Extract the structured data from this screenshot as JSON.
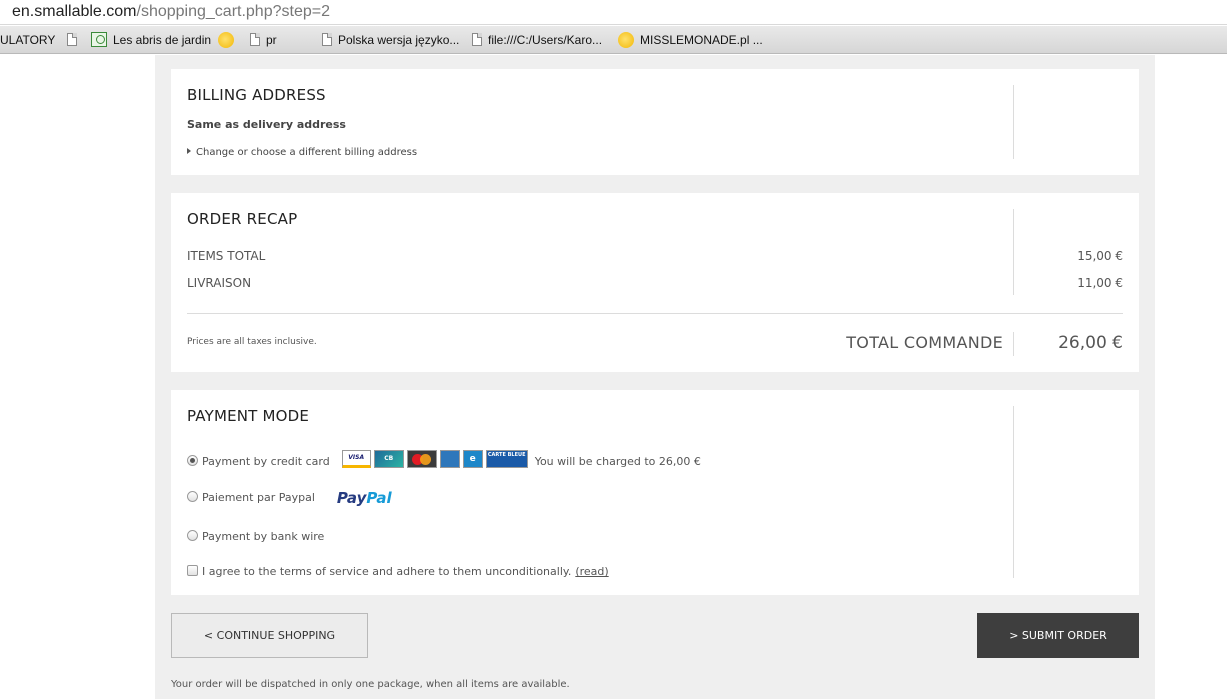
{
  "browser": {
    "url_host": "en.smallable.com",
    "url_path": "/shopping_cart.php?step=2",
    "bookmarks": [
      {
        "label": "ULATORY",
        "icon": "none"
      },
      {
        "label": "",
        "icon": "page-icon"
      },
      {
        "label": "Les abris de jardin",
        "icon": "tree-icon"
      },
      {
        "label": "",
        "icon": "hand-icon"
      },
      {
        "label": "pr",
        "icon": "page-icon"
      },
      {
        "label": "Polska wersja językо...",
        "icon": "page-icon"
      },
      {
        "label": "file:///C:/Users/Karo...",
        "icon": "page-icon"
      },
      {
        "label": "MISSLEMONADE.pl ...",
        "icon": "hand-icon"
      }
    ]
  },
  "billing": {
    "title": "BILLING ADDRESS",
    "same_as": "Same as delivery address",
    "change_link": "Change or choose a different billing address"
  },
  "recap": {
    "title": "ORDER RECAP",
    "lines": [
      {
        "label": "ITEMS TOTAL",
        "value": "15,00 €"
      },
      {
        "label": "LIVRAISON",
        "value": "11,00 €"
      }
    ],
    "taxes_note": "Prices are all taxes inclusive.",
    "total_label": "TOTAL COMMANDE",
    "total_value": "26,00 €"
  },
  "payment": {
    "title": "PAYMENT MODE",
    "options": [
      {
        "label": "Payment by credit card",
        "checked": true
      },
      {
        "label": "Paiement par Paypal",
        "checked": false
      },
      {
        "label": "Payment by bank wire",
        "checked": false
      }
    ],
    "cards": [
      "VISA",
      "CB",
      "MasterCard",
      "AMEX",
      "e",
      "CARTE BLEUE"
    ],
    "charge_note": "You will be charged to 26,00 €",
    "paypal_logo": {
      "pay": "Pay",
      "pal": "Pal"
    },
    "terms_text": "I agree to the terms of service and adhere to them unconditionally.",
    "terms_link": "(read)"
  },
  "actions": {
    "continue": "< CONTINUE SHOPPING",
    "submit": "> SUBMIT ORDER"
  },
  "dispatch_note": "Your order will be dispatched in only one package, when all items are available."
}
